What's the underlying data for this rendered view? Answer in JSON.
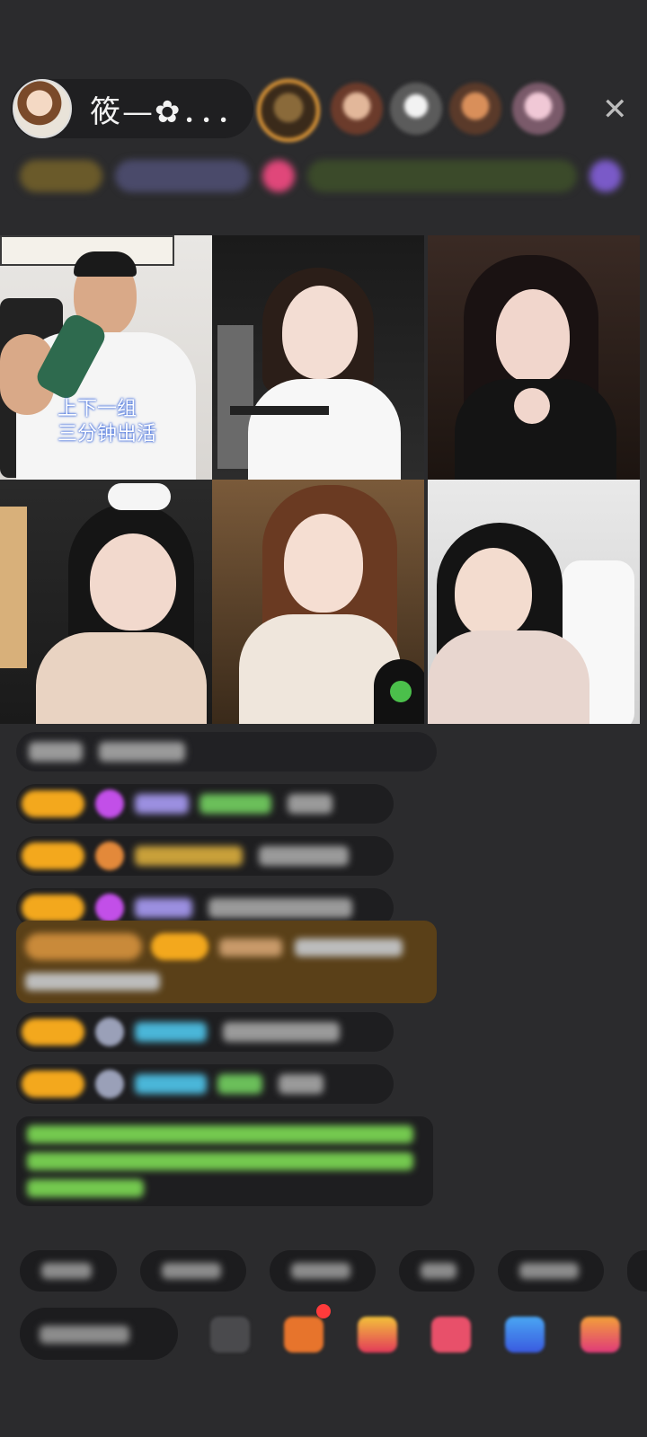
{
  "header": {
    "host_name": "筱—✿．．．",
    "close_icon_glyph": "✕"
  },
  "grid": {
    "captions": {
      "tile1": "上下一组\n三分钟出活"
    }
  },
  "colors": {
    "background": "#2b2b2d",
    "highlight_bg": "#5a4018",
    "badge_yellow": "#f3a81d",
    "notice_text_green": "#74c94f",
    "accent_orange": "#f0a33a"
  }
}
